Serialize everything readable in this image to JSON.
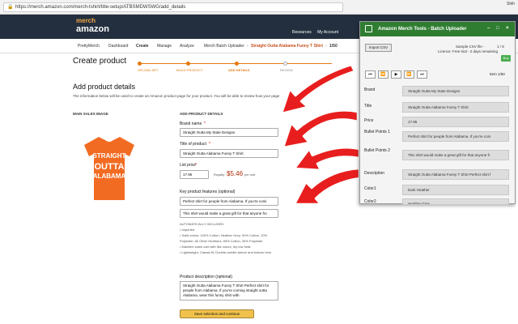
{
  "browser": {
    "url": "https://merch.amazon.com/merch-tshirt/title-setup/ATBSMDWSWG/add_details",
    "right_text": "Shih"
  },
  "amazon": {
    "logo_top": "merch",
    "logo_bottom": "amazon",
    "top_links": [
      "Resources",
      "My Account"
    ]
  },
  "subnav": {
    "items": [
      "PrettyMerch",
      "Dashboard",
      "Create",
      "Manage",
      "Analyze",
      "Merch Batch Uploader"
    ],
    "current_title": "Straight Outta Alabama Funny T Shirt",
    "counter": "1/50"
  },
  "page": {
    "title": "Create product",
    "steps": [
      "UPLOAD ART",
      "BUILD PRODUCT",
      "ADD DETAILS",
      "REVIEW"
    ],
    "heading": "Add product details",
    "intro": "The information below will be used to create an Amazon product page for your product. You will be able to review how your page",
    "left_col": "MAIN SALES IMAGE",
    "right_col": "ADD PRODUCT DETAILS",
    "shirt_text": [
      "STRAIGHT",
      "OUTTA",
      "ALABAMA"
    ],
    "brand_label": "Brand name",
    "brand_value": "Straight Outta My State Designs",
    "title_label": "Title of product",
    "title_value": "Straight Outta Alabama Funny T Shirt",
    "price_label": "List price",
    "price_value": "17.95",
    "royalty_label": "Royalty",
    "royalty_value": "$5.46",
    "royalty_unit": "per unit",
    "features_label": "Key product features (optional)",
    "feature1": "Perfect shirt for people from Alabama. If you're comi",
    "feature2": "This shirt would make a great gift for that anyone fro",
    "auto_label": "AUTOMATICALLY INCLUDED:",
    "auto_items": [
      "Imported",
      "Solid colors: 100% Cotton; Heather Grey: 90% Cotton, 10% Polyester; All Other Heathers: 65% Cotton, 35% Polyester",
      "Machine wash cold with like colors, dry low heat",
      "Lightweight, Classic fit, Double-needle sleeve and bottom hem"
    ],
    "desc_label": "Product description (optional)",
    "desc_value": "Straight Outta Alabama Funny T Shirt Perfect shirt for people from Alabama. If you're coming straight outta Alabama, wear this funny shirt with",
    "save_label": "Save selection and continue"
  },
  "panel": {
    "title": "Amazon Merch Tools - Batch Uploader",
    "import_label": "Import CSV",
    "sample": "Sample CSV file -",
    "sample_count": "1 / 9",
    "licence": "Licence: Free trial - 2 days remaining",
    "buy_label": "Buy",
    "controls": [
      "⏮",
      "⏪",
      "▶",
      "⏩",
      "⏭"
    ],
    "item_counter": "Item 1/50",
    "rows": [
      {
        "label": "Brand",
        "value": "Straight Outta My State Designs"
      },
      {
        "label": "Title",
        "value": "Straight Outta Alabama Funny T Shirt"
      },
      {
        "label": "Price",
        "value": "17.95"
      },
      {
        "label": "Bullet Points 1",
        "value": "Perfect shirt for people from Alabama. If you're com"
      },
      {
        "label": "Bullet Points 2",
        "value": "This shirt would make a great gift for that anyone fr"
      },
      {
        "label": "Description",
        "value": "Straight Outta Alabama Funny T Shirt Perfect shirt f"
      },
      {
        "label": "Color1",
        "value": "Dark Heather"
      },
      {
        "label": "Color2",
        "value": "Heather Grey"
      }
    ]
  },
  "colors": {
    "amazon_nav": "#232f3e",
    "accent_orange": "#e47911",
    "panel_green": "#2f7d31",
    "arrow_red": "#e81e1e",
    "shirt_orange": "#f26b22",
    "button_yellow": "#f0c14b"
  }
}
